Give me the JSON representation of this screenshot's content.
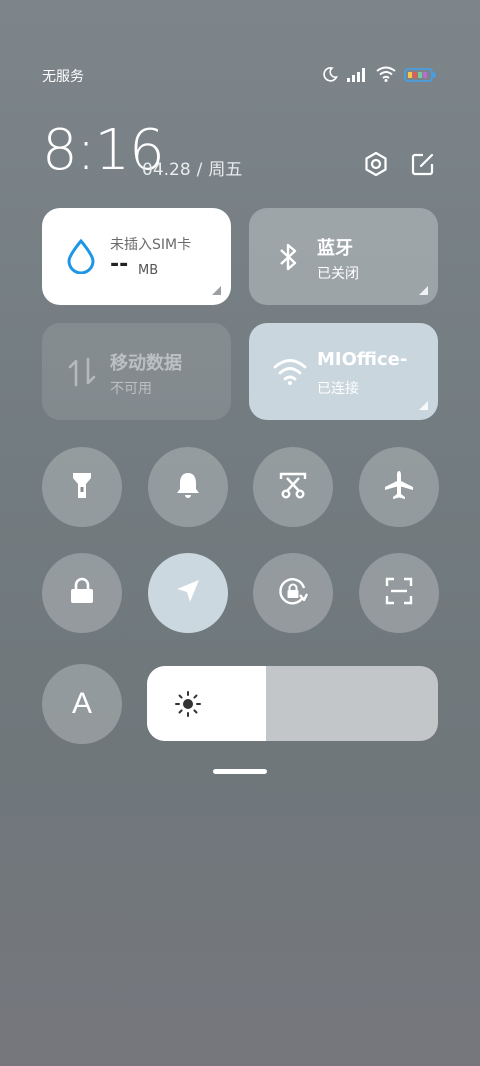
{
  "status_bar": {
    "carrier": "无服务",
    "icons": [
      "moon-icon",
      "signal-icon",
      "wifi-icon",
      "battery-icon"
    ]
  },
  "header": {
    "time": "8:16",
    "date": "04.28",
    "separator": "/",
    "weekday": "周五",
    "icons": [
      "settings-icon",
      "edit-icon"
    ]
  },
  "tiles": {
    "data_usage": {
      "title": "未插入SIM卡",
      "value": "--",
      "unit": "MB",
      "icon": "water-drop-icon"
    },
    "bluetooth": {
      "title": "蓝牙",
      "status": "已关闭",
      "icon": "bluetooth-icon"
    },
    "mobile_data": {
      "title": "移动数据",
      "status": "不可用",
      "icon": "data-arrows-icon"
    },
    "wifi": {
      "title": "MIOffice-",
      "status": "已连接",
      "icon": "wifi-icon"
    }
  },
  "toggles": [
    {
      "name": "flashlight",
      "icon": "flashlight-icon",
      "active": false
    },
    {
      "name": "mute",
      "icon": "bell-icon",
      "active": false
    },
    {
      "name": "screenshot",
      "icon": "scissors-icon",
      "active": false
    },
    {
      "name": "airplane",
      "icon": "airplane-icon",
      "active": false
    },
    {
      "name": "lock",
      "icon": "lock-icon",
      "active": false
    },
    {
      "name": "location",
      "icon": "location-arrow-icon",
      "active": true
    },
    {
      "name": "rotation-lock",
      "icon": "rotation-lock-icon",
      "active": false
    },
    {
      "name": "scanner",
      "icon": "scan-icon",
      "active": false
    }
  ],
  "auto_brightness": {
    "label": "A"
  },
  "brightness": {
    "level": 0.41,
    "icon": "sun-icon"
  },
  "colors": {
    "accent_blue": "#1e96e8",
    "active_tile": "#c9d6de",
    "tile_white": "#ffffff"
  }
}
